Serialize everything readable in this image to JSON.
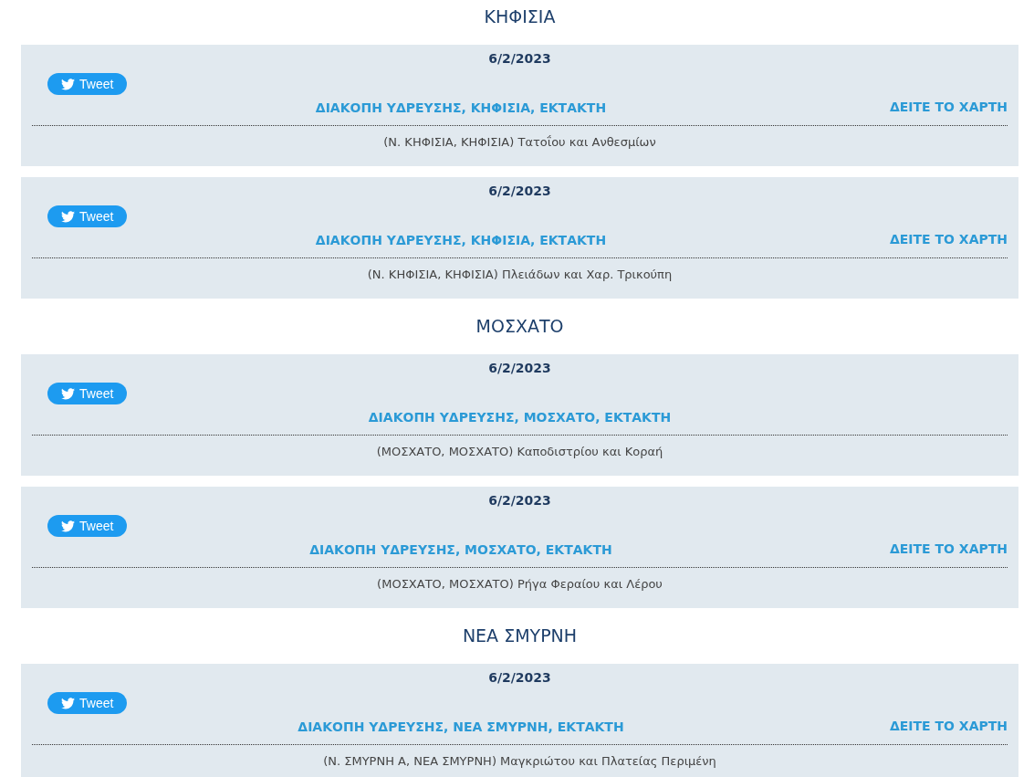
{
  "sections": [
    {
      "title": "ΚΗΦΙΣΙΑ",
      "items": [
        {
          "date": "6/2/2023",
          "tweet_label": "Tweet",
          "title": "ΔΙΑΚΟΠΗ ΥΔΡΕΥΣΗΣ, ΚΗΦΙΣΙΑ, ΕΚΤΑΚΤΗ",
          "map_link": "ΔΕΙΤΕ ΤΟ ΧΑΡΤΗ",
          "address": "(Ν. ΚΗΦΙΣΙΑ, ΚΗΦΙΣΙΑ) Τατοΐου και Ανθεσμίων"
        },
        {
          "date": "6/2/2023",
          "tweet_label": "Tweet",
          "title": "ΔΙΑΚΟΠΗ ΥΔΡΕΥΣΗΣ, ΚΗΦΙΣΙΑ, ΕΚΤΑΚΤΗ",
          "map_link": "ΔΕΙΤΕ ΤΟ ΧΑΡΤΗ",
          "address": "(Ν. ΚΗΦΙΣΙΑ, ΚΗΦΙΣΙΑ) Πλειάδων και Χαρ. Τρικούπη"
        }
      ]
    },
    {
      "title": "ΜΟΣΧΑΤΟ",
      "items": [
        {
          "date": "6/2/2023",
          "tweet_label": "Tweet",
          "title": "ΔΙΑΚΟΠΗ ΥΔΡΕΥΣΗΣ, ΜΟΣΧΑΤΟ, ΕΚΤΑΚΤΗ",
          "address": "(ΜΟΣΧΑΤΟ, ΜΟΣΧΑΤΟ) Καποδιστρίου και Κοραή"
        },
        {
          "date": "6/2/2023",
          "tweet_label": "Tweet",
          "title": "ΔΙΑΚΟΠΗ ΥΔΡΕΥΣΗΣ, ΜΟΣΧΑΤΟ, ΕΚΤΑΚΤΗ",
          "map_link": "ΔΕΙΤΕ ΤΟ ΧΑΡΤΗ",
          "address": "(ΜΟΣΧΑΤΟ, ΜΟΣΧΑΤΟ) Ρήγα Φεραίου και Λέρου"
        }
      ]
    },
    {
      "title": "ΝΕΑ ΣΜΥΡΝΗ",
      "items": [
        {
          "date": "6/2/2023",
          "tweet_label": "Tweet",
          "title": "ΔΙΑΚΟΠΗ ΥΔΡΕΥΣΗΣ, ΝΕΑ ΣΜΥΡΝΗ, ΕΚΤΑΚΤΗ",
          "map_link": "ΔΕΙΤΕ ΤΟ ΧΑΡΤΗ",
          "address": "(Ν. ΣΜΥΡΝΗ Α, ΝΕΑ ΣΜΥΡΝΗ) Μαγκριώτου και Πλατείας Περιμένη"
        }
      ]
    }
  ]
}
